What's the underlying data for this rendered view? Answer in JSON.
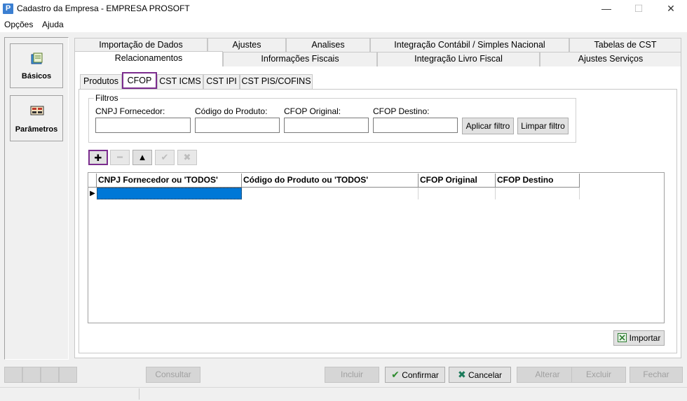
{
  "window": {
    "title": "Cadastro da Empresa - EMPRESA PROSOFT",
    "app_icon_letter": "P",
    "controls": {
      "minimize": "—",
      "maximize": "☐",
      "close": "✕"
    }
  },
  "menu": {
    "items": [
      "Opções",
      "Ajuda"
    ]
  },
  "sidebar": {
    "items": [
      {
        "label": "Básicos",
        "icon": "basicos-icon"
      },
      {
        "label": "Parâmetros",
        "icon": "parametros-icon"
      }
    ]
  },
  "main_tabs": {
    "row1": [
      "Importação de Dados",
      "Ajustes",
      "Analises",
      "Integração Contábil / Simples Nacional",
      "Tabelas de CST"
    ],
    "row2": [
      "Relacionamentos",
      "Informações Fiscais",
      "Integração Livro Fiscal",
      "Ajustes Serviços"
    ],
    "active": "Relacionamentos"
  },
  "sub_tabs": {
    "items": [
      "Produtos",
      "CFOP",
      "CST ICMS",
      "CST IPI",
      "CST PIS/COFINS"
    ],
    "active": "CFOP"
  },
  "filters": {
    "legend": "Filtros",
    "fields": [
      {
        "label": "CNPJ Fornecedor:",
        "value": ""
      },
      {
        "label": "Código do Produto:",
        "value": ""
      },
      {
        "label": "CFOP Original:",
        "value": ""
      },
      {
        "label": "CFOP Destino:",
        "value": ""
      }
    ],
    "apply_label": "Aplicar filtro",
    "clear_label": "Limpar filtro"
  },
  "toolbar": {
    "add": "✚",
    "remove": "━",
    "up": "▲",
    "confirm": "✔",
    "cancel": "✖"
  },
  "grid": {
    "columns": [
      "CNPJ Fornecedor ou 'TODOS'",
      "Código do Produto ou 'TODOS'",
      "CFOP Original",
      "CFOP Destino"
    ],
    "rows": [
      [
        "",
        "",
        "",
        ""
      ]
    ],
    "row_indicator": "▶"
  },
  "import_label": "Importar",
  "bottom_buttons": {
    "consultar": "Consultar",
    "incluir": "Incluir",
    "confirmar": "Confirmar",
    "cancelar": "Cancelar",
    "alterar": "Alterar",
    "excluir": "Excluir",
    "fechar": "Fechar"
  },
  "colors": {
    "highlight": "#7b2d8e",
    "selection": "#0078d7",
    "confirm_green": "#2e8b2e",
    "cancel_green": "#1a7a5a"
  }
}
